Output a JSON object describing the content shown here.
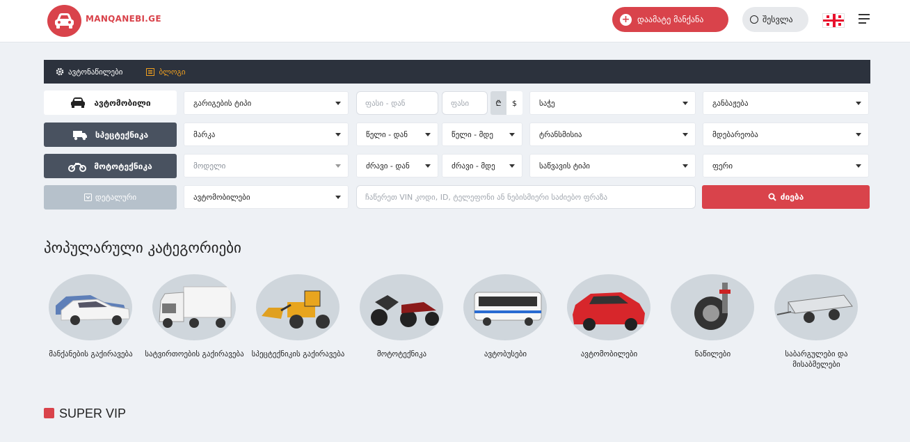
{
  "header": {
    "logo_text": "MANQANEBI.GE",
    "add_car_label": "დაამატე მანქანა",
    "login_label": "შესვლა",
    "language_icon": "georgia-flag-icon",
    "menu_icon": "hamburger-menu-icon"
  },
  "navbar": {
    "items": [
      {
        "label": "ავტონაწილები",
        "icon": "gear-icon"
      },
      {
        "label": "ბლოგი",
        "icon": "list-icon"
      }
    ]
  },
  "vehicle_types": {
    "car": "ავტომობილი",
    "special": "სპეცტექნიკა",
    "moto": "მოტოტექნიკა",
    "detailed": "დეტალური"
  },
  "filters": {
    "body_type": "გარიგების ტიპი",
    "price_from": "ფასი - დან",
    "price_to": "ფასი",
    "currency_lari": "₾",
    "currency_usd": "$",
    "wheel": "საჭე",
    "clearance": "განბაჟება",
    "make": "მარკა",
    "year_from": "წელი - დან",
    "year_to": "წელი - მდე",
    "transmission": "ტრანსმისია",
    "location": "მდებარეობა",
    "model": "მოდელი",
    "engine_from": "ძრავი - დან",
    "engine_to": "ძრავი - მდე",
    "fuel_type": "საწვავის ტიპი",
    "color": "ფერი",
    "category": "ავტომობილები",
    "search_placeholder": "ჩაწერეთ VIN კოდი, ID, ტელეფონი ან ნებისმიერი საძიებო ფრაზა",
    "search_button": "ძიება"
  },
  "popular": {
    "title": "პოპულარული კატეგორიები",
    "categories": [
      {
        "label": "მანქანების გაქირავება"
      },
      {
        "label": "სატვირთოების გაქირავება"
      },
      {
        "label": "სპეცტექნიკის გაქირავება"
      },
      {
        "label": "მოტოტექნიკა"
      },
      {
        "label": "ავტობუსები"
      },
      {
        "label": "ავტომობილები"
      },
      {
        "label": "ნაწილები"
      },
      {
        "label": "საბარგულები და მისაბმელები"
      }
    ]
  },
  "super_vip": {
    "label": "SUPER VIP"
  },
  "colors": {
    "accent": "#d9434b",
    "dark_nav": "#2c323d",
    "blog": "#f0a020"
  }
}
